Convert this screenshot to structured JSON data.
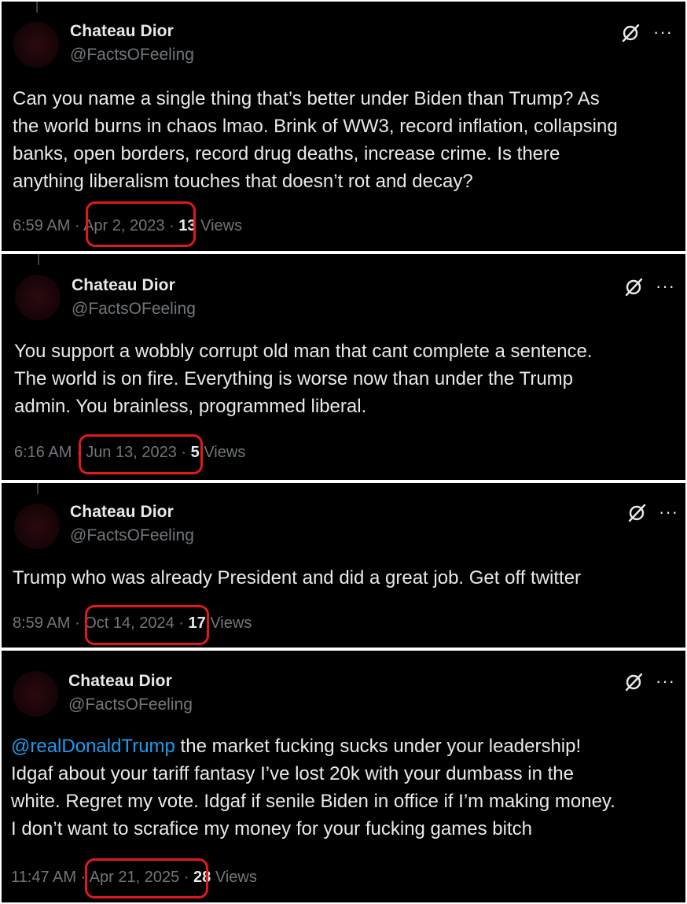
{
  "tweets": [
    {
      "name": "Chateau Dior",
      "handle": "@FactsOFeeling",
      "mention": "",
      "text": "Can you name a single thing that’s better under Biden than Trump? As\nthe world burns in chaos lmao. Brink of WW3, record inflation, collapsing\nbanks, open borders, record drug deaths, increase crime. Is there\nanything liberalism touches that doesn’t rot and decay?",
      "time": "6:59 AM",
      "sep1": "·",
      "date": "Apr 2, 2023",
      "sep2": "·",
      "views_count": "13",
      "views_label": "Views"
    },
    {
      "name": "Chateau Dior",
      "handle": "@FactsOFeeling",
      "mention": "",
      "text": "You support a wobbly corrupt old man that cant complete a sentence.\nThe world is on fire. Everything is worse now than under the Trump\nadmin. You brainless, programmed liberal.",
      "time": "6:16 AM",
      "sep1": "·",
      "date": "Jun 13, 2023",
      "sep2": "·",
      "views_count": "5",
      "views_label": "Views"
    },
    {
      "name": "Chateau Dior",
      "handle": "@FactsOFeeling",
      "mention": "",
      "text": "Trump who was already President and did a great job. Get off twitter",
      "time": "8:59 AM",
      "sep1": "·",
      "date": "Oct 14, 2024",
      "sep2": "·",
      "views_count": "17",
      "views_label": "Views"
    },
    {
      "name": "Chateau Dior",
      "handle": "@FactsOFeeling",
      "mention": "@realDonaldTrump",
      "text": " the market fucking sucks under your leadership!\nIdgaf about your tariff fantasy I’ve lost 20k with your dumbass in the\nwhite. Regret my vote. Idgaf if senile Biden in office if I’m making money.\nI don’t want to scrafice my money for your fucking games bitch",
      "time": "11:47 AM",
      "sep1": "·",
      "date": "Apr 21, 2025",
      "sep2": "·",
      "views_count": "28",
      "views_label": "Views"
    }
  ],
  "icons": {
    "grok": "grok-icon",
    "more": "more-dots-icon",
    "more_glyph": "···"
  },
  "colors": {
    "background": "#000000",
    "text": "#e7e9ea",
    "muted": "#71767b",
    "link": "#1d9bf0",
    "highlight": "#e01a1a"
  }
}
